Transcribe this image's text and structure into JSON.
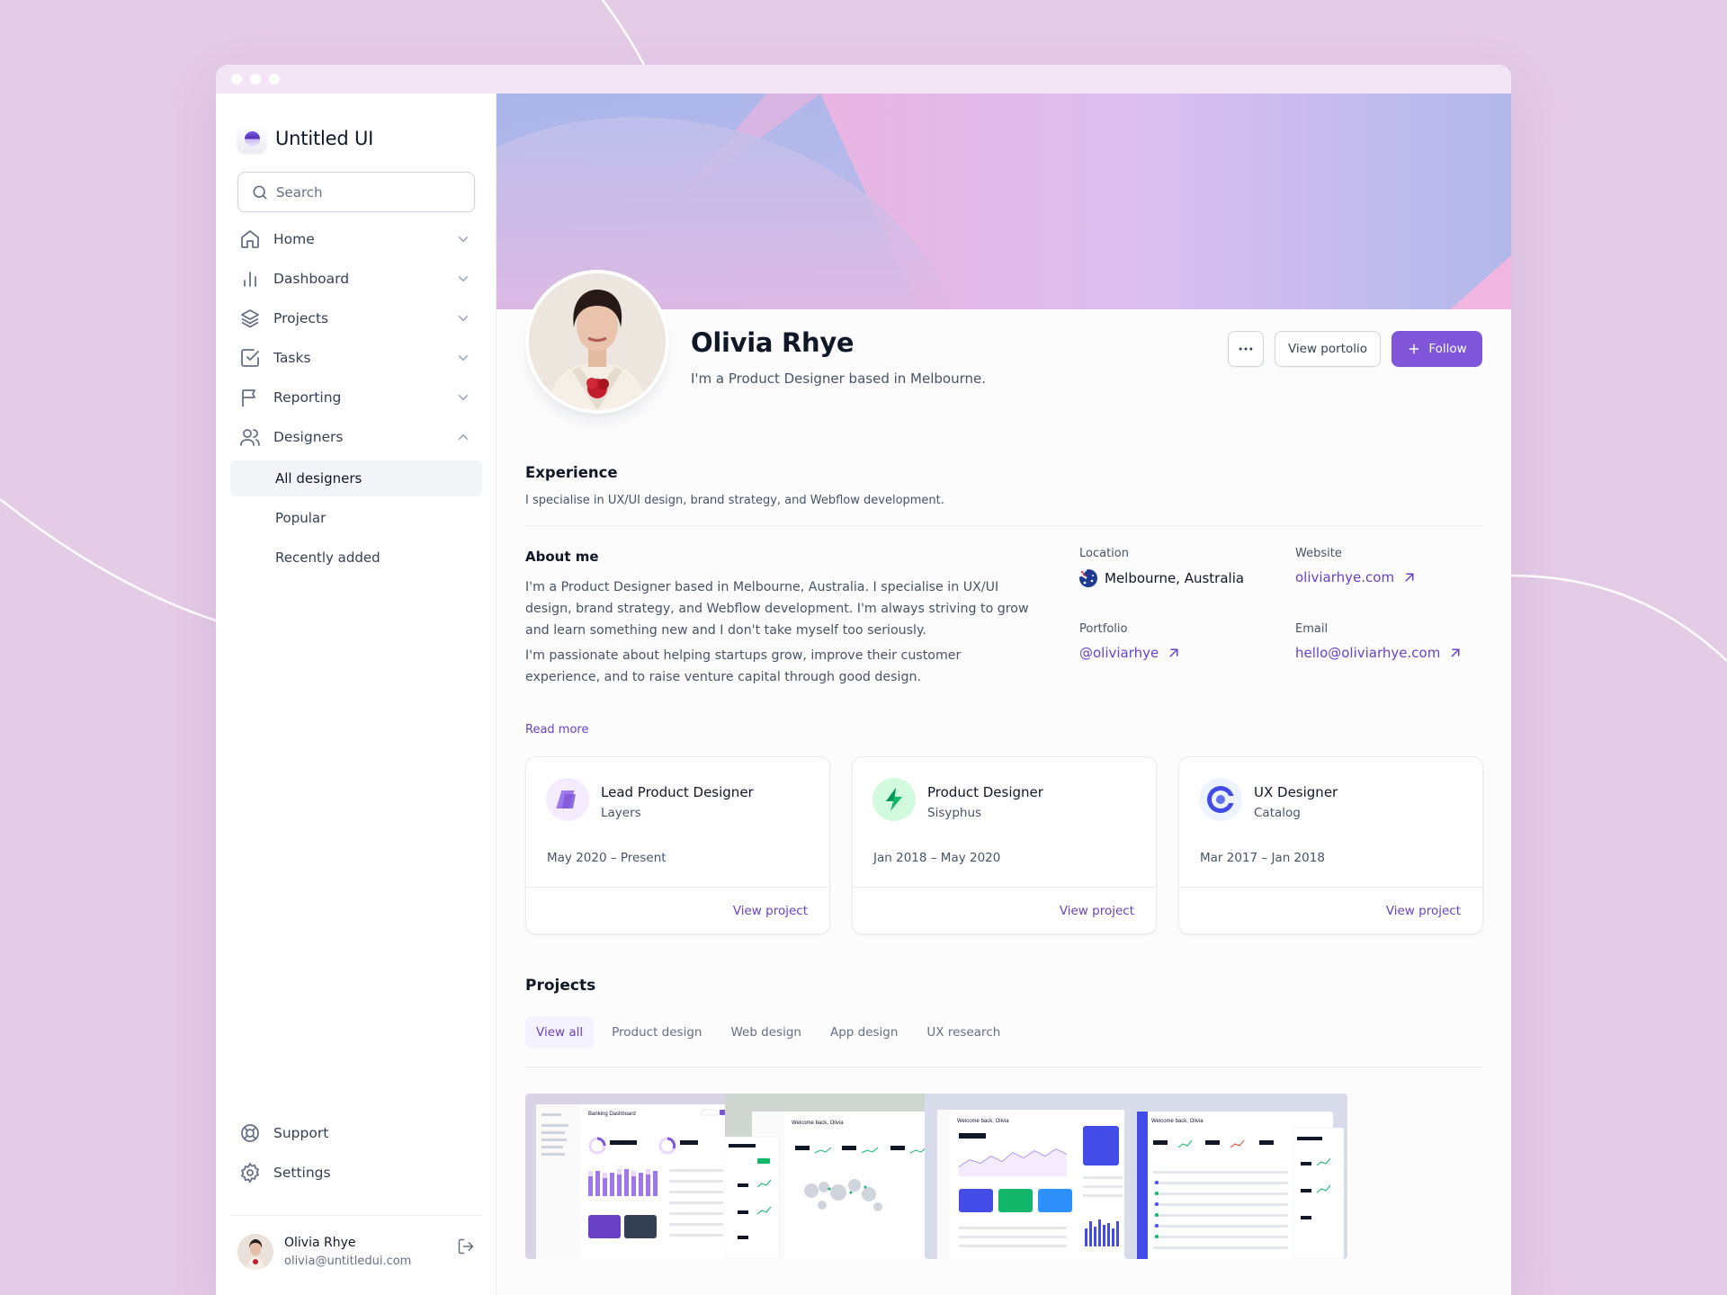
{
  "app": {
    "name": "Untitled UI"
  },
  "search": {
    "placeholder": "Search"
  },
  "nav": {
    "items": [
      {
        "label": "Home"
      },
      {
        "label": "Dashboard"
      },
      {
        "label": "Projects"
      },
      {
        "label": "Tasks"
      },
      {
        "label": "Reporting"
      },
      {
        "label": "Designers"
      }
    ],
    "designers_sub": [
      {
        "label": "All designers",
        "active": true
      },
      {
        "label": "Popular"
      },
      {
        "label": "Recently added"
      }
    ],
    "bottom": [
      {
        "label": "Support"
      },
      {
        "label": "Settings"
      }
    ]
  },
  "user": {
    "name": "Olivia Rhye",
    "email": "olivia@untitledui.com"
  },
  "profile": {
    "name": "Olivia Rhye",
    "subtitle": "I'm a Product Designer based in Melbourne.",
    "view_portfolio_label": "View portolio",
    "follow_label": "Follow"
  },
  "experience": {
    "heading": "Experience",
    "text": "I specialise in UX/UI design, brand strategy, and Webflow development."
  },
  "about": {
    "heading": "About me",
    "paragraphs": [
      "I'm a Product Designer based in Melbourne, Australia. I specialise in UX/UI design, brand strategy, and Webflow development. I'm always striving to grow and learn something new and I don't take myself too seriously.",
      "I'm passionate about helping startups grow, improve their customer experience, and to raise venture capital through good design."
    ],
    "read_more": "Read more"
  },
  "details": {
    "location": {
      "label": "Location",
      "value": "Melbourne, Australia"
    },
    "website": {
      "label": "Website",
      "value": "oliviarhye.com"
    },
    "portfolio": {
      "label": "Portfolio",
      "value": "@oliviarhye"
    },
    "email": {
      "label": "Email",
      "value": "hello@oliviarhye.com"
    }
  },
  "jobs": [
    {
      "role": "Lead Product Designer",
      "company": "Layers",
      "dates": "May 2020 – Present",
      "link": "View project",
      "icon": "layers-logo-icon",
      "color": "#7f56d9"
    },
    {
      "role": "Product Designer",
      "company": "Sisyphus",
      "dates": "Jan 2018 – May 2020",
      "link": "View project",
      "icon": "sisyphus-logo-icon",
      "color": "#12b76a"
    },
    {
      "role": "UX Designer",
      "company": "Catalog",
      "dates": "Mar 2017 – Jan 2018",
      "link": "View project",
      "icon": "catalog-logo-icon",
      "color": "#444ce7"
    }
  ],
  "projects": {
    "heading": "Projects",
    "tabs": [
      {
        "label": "View all",
        "active": true
      },
      {
        "label": "Product design"
      },
      {
        "label": "Web design"
      },
      {
        "label": "App design"
      },
      {
        "label": "UX research"
      }
    ],
    "thumbnails": [
      {
        "title": "Banking Dashboard",
        "bg": "#d8d4e6"
      },
      {
        "title": "Welcome back, Olivia",
        "bg": "#cfd6cf"
      },
      {
        "title": "Welcome back, Olivia",
        "bg": "#d8dbe9"
      },
      {
        "title": "Welcome back, Olivia",
        "bg": "#d8dbe9"
      }
    ]
  },
  "colors": {
    "accent": "#7f56d9",
    "accent_text": "#6941c6",
    "background": "#e4cbe6"
  }
}
